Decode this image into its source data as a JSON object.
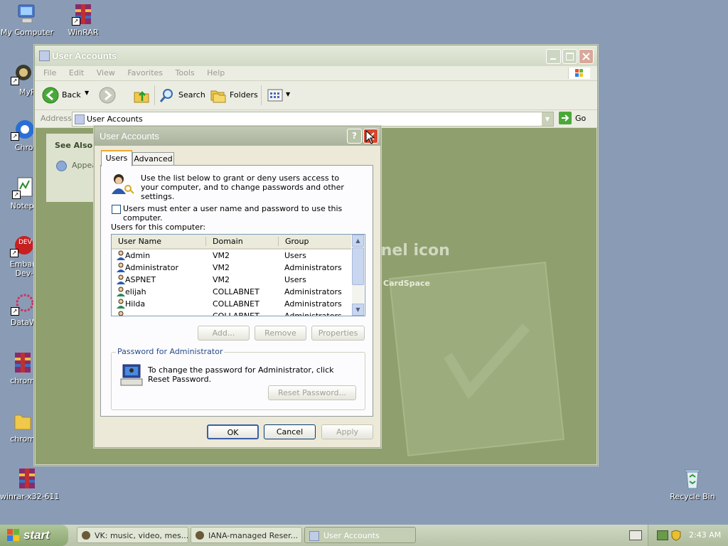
{
  "desktop": {
    "icons": [
      {
        "label": "My Computer"
      },
      {
        "label": "WinRAR"
      },
      {
        "label": "MyPal"
      },
      {
        "label": "Chrom"
      },
      {
        "label": "Notepad"
      },
      {
        "label": "Embarca Dev-C"
      },
      {
        "label": "DataWag"
      },
      {
        "label": "chrome"
      },
      {
        "label": "chrome"
      },
      {
        "label": "winrar-x32-611"
      },
      {
        "label": "Recycle Bin"
      }
    ]
  },
  "explorer": {
    "title": "User Accounts",
    "menu": [
      "File",
      "Edit",
      "View",
      "Favorites",
      "Tools",
      "Help"
    ],
    "toolbar": {
      "back": "Back",
      "search": "Search",
      "folders": "Folders"
    },
    "address_label": "Address",
    "address_value": "User Accounts",
    "go": "Go",
    "see_also": "See Also",
    "see_also_item": "Appear",
    "bg_text": "nnel icon",
    "bg_link": "CardSpace"
  },
  "dialog": {
    "title": "User Accounts",
    "tabs": [
      "Users",
      "Advanced"
    ],
    "intro": "Use the list below to grant or deny users access to your computer, and to change passwords and other settings.",
    "checkbox_label": "Users must enter a user name and password to use this computer.",
    "checkbox_checked": false,
    "list_label": "Users for this computer:",
    "columns": [
      "User Name",
      "Domain",
      "Group"
    ],
    "users": [
      {
        "name": "Admin",
        "domain": "VM2",
        "group": "Users"
      },
      {
        "name": "Administrator",
        "domain": "VM2",
        "group": "Administrators"
      },
      {
        "name": "ASPNET",
        "domain": "VM2",
        "group": "Users"
      },
      {
        "name": "elijah",
        "domain": "COLLABNET",
        "group": "Administrators"
      },
      {
        "name": "Hilda",
        "domain": "COLLABNET",
        "group": "Administrators"
      },
      {
        "name": "",
        "domain": "COLLABNET",
        "group": "Administrators"
      }
    ],
    "buttons": {
      "add": "Add...",
      "remove": "Remove",
      "properties": "Properties"
    },
    "password_group": "Password for Administrator",
    "password_text": "To change the password for Administrator, click Reset Password.",
    "reset_button": "Reset Password...",
    "ok": "OK",
    "cancel": "Cancel",
    "apply": "Apply"
  },
  "taskbar": {
    "start": "start",
    "items": [
      "VK: music, video, mes...",
      "IANA-managed Reser...",
      "User Accounts"
    ],
    "clock": "2:43 AM"
  },
  "colors": {
    "desktop": "#8a9cb5",
    "content_bg": "#8f9f6e",
    "close_red": "#d9452c",
    "start_green": "#3c8a2e"
  }
}
